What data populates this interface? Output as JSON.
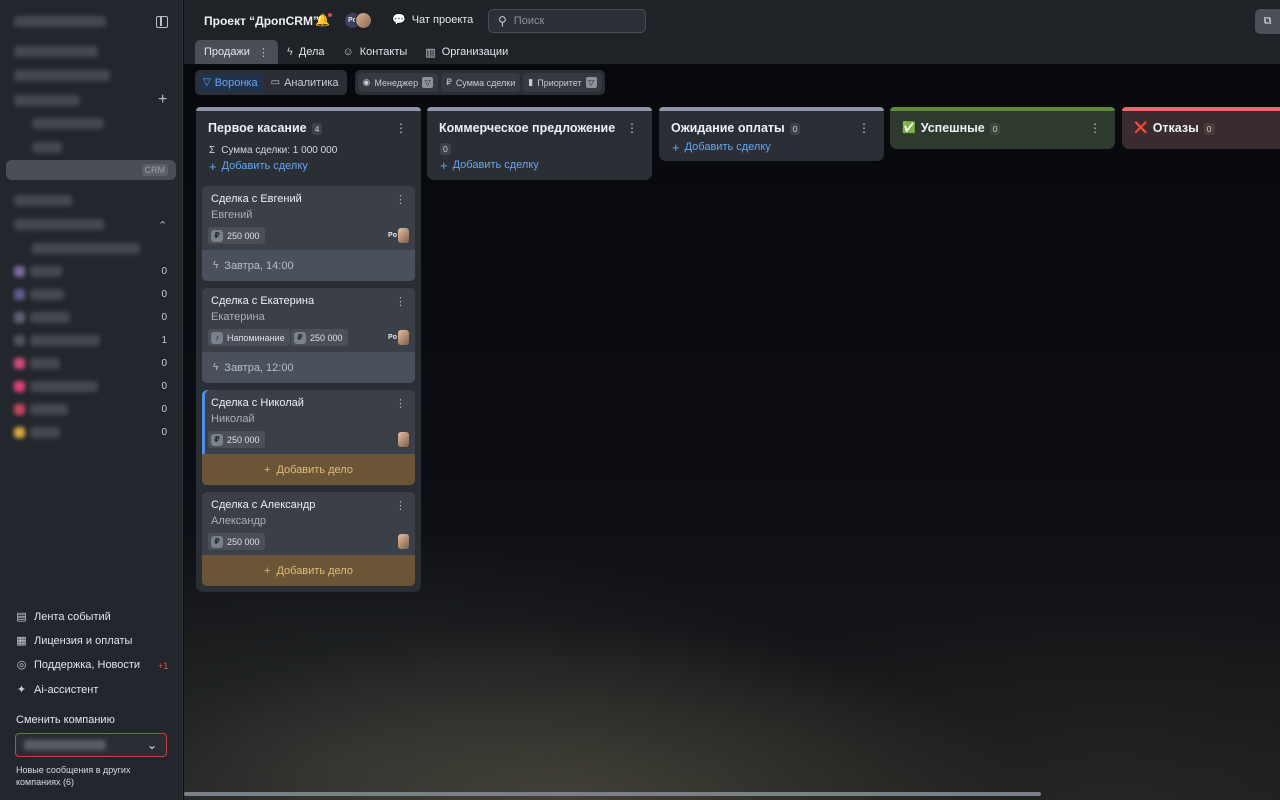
{
  "sidebar": {
    "items": [
      {
        "count": "0"
      },
      {
        "count": "0"
      },
      {
        "count": "0"
      },
      {
        "count": "1"
      },
      {
        "count": "0"
      },
      {
        "count": "0"
      },
      {
        "count": "0"
      },
      {
        "count": "0"
      }
    ],
    "selected_tag": "CRM",
    "bottom_menu": [
      {
        "label": "Лента событий",
        "icon": "feed-icon"
      },
      {
        "label": "Лицензия и оплаты",
        "icon": "license-icon"
      },
      {
        "label": "Поддержка, Новости",
        "icon": "support-icon",
        "badge": "+1"
      },
      {
        "label": "Ai-ассистент",
        "icon": "sparkle-icon"
      }
    ],
    "switch_company_label": "Сменить компанию",
    "new_messages_note": "Новые сообщения в других компаниях (6)"
  },
  "header": {
    "project_title": "Проект “ДропCRM”",
    "avatar_initials": "Po",
    "chat_label": "Чат проекта",
    "search_placeholder": "Поиск",
    "tabs": [
      {
        "label": "Продажи",
        "active": true
      },
      {
        "label": "Дела",
        "icon": "bolt-icon"
      },
      {
        "label": "Контакты",
        "icon": "person-icon"
      },
      {
        "label": "Организации",
        "icon": "building-icon"
      }
    ]
  },
  "viewbar": {
    "views": [
      {
        "label": "Воронка",
        "active": true,
        "icon": "funnel-icon"
      },
      {
        "label": "Аналитика",
        "icon": "analytics-icon"
      }
    ],
    "filters": [
      {
        "label": "Менеджер",
        "icon": "user-circle-icon"
      },
      {
        "label": "Сумма сделки",
        "icon": "ruble-icon"
      },
      {
        "label": "Приоритет",
        "icon": "bars-icon"
      }
    ]
  },
  "colors": {
    "accent": "#6aa6f2",
    "danger": "#e0564f",
    "success_column": "#5a8a3a",
    "failure_column": "#e26c6c",
    "task_button": "#6a5636"
  },
  "board": {
    "add_deal_label": "Добавить сделку",
    "add_task_label": "Добавить дело",
    "columns": [
      {
        "title": "Первое касание",
        "count": "4",
        "sum_label": "Сумма сделки: 1 000 000",
        "cards": [
          {
            "title": "Сделка с Евгений",
            "contact": "Евгений",
            "amount": "250 000",
            "avatar": "Po",
            "footer": "Завтра, 14:00"
          },
          {
            "title": "Сделка с Екатерина",
            "contact": "Екатерина",
            "reminder": "Напоминание",
            "amount": "250 000",
            "avatar": "Po",
            "footer": "Завтра, 12:00"
          },
          {
            "title": "Сделка с Николай",
            "contact": "Николай",
            "amount": "250 000"
          },
          {
            "title": "Сделка с Александр",
            "contact": "Александр",
            "amount": "250 000"
          }
        ]
      },
      {
        "title": "Коммерческое предложение",
        "count": "0"
      },
      {
        "title": "Ожидание оплаты",
        "count": "0"
      },
      {
        "title": "Успешные",
        "count": "0",
        "emoji": "✅"
      },
      {
        "title": "Отказы",
        "count": "0",
        "emoji": "❌"
      }
    ]
  }
}
